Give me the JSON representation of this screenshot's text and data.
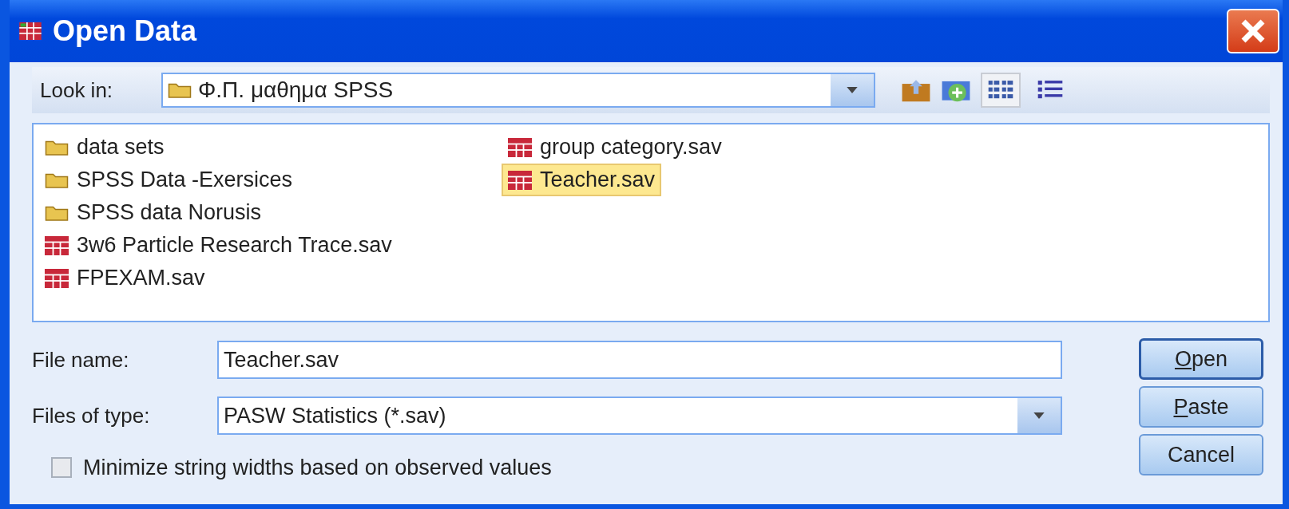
{
  "window": {
    "title": "Open Data"
  },
  "look_in": {
    "label": "Look in:",
    "value": "Φ.Π. μαθημα SPSS"
  },
  "view_buttons": [
    {
      "kind": "list",
      "selected": true
    },
    {
      "kind": "details",
      "selected": false
    }
  ],
  "files": [
    {
      "name": "data sets",
      "kind": "folder",
      "selected": false
    },
    {
      "name": "SPSS Data -Exersices",
      "kind": "folder",
      "selected": false
    },
    {
      "name": "SPSS data Norusis",
      "kind": "folder",
      "selected": false
    },
    {
      "name": "3w6 Particle Research Trace.sav",
      "kind": "sav",
      "selected": false
    },
    {
      "name": "FPEXAM.sav",
      "kind": "sav",
      "selected": false
    },
    {
      "name": "group category.sav",
      "kind": "sav",
      "selected": false
    },
    {
      "name": "Teacher.sav",
      "kind": "sav",
      "selected": true
    }
  ],
  "file_name": {
    "label": "File name:",
    "value": "Teacher.sav"
  },
  "file_type": {
    "label": "Files of type:",
    "value": "PASW Statistics (*.sav)"
  },
  "minimize_option": {
    "label": "Minimize string widths based on observed values",
    "checked": false
  },
  "buttons": [
    {
      "label": "Open",
      "mnemonic": true,
      "default": true
    },
    {
      "label": "Paste",
      "mnemonic": true,
      "default": false
    },
    {
      "label": "Cancel",
      "mnemonic": false,
      "default": false
    }
  ]
}
